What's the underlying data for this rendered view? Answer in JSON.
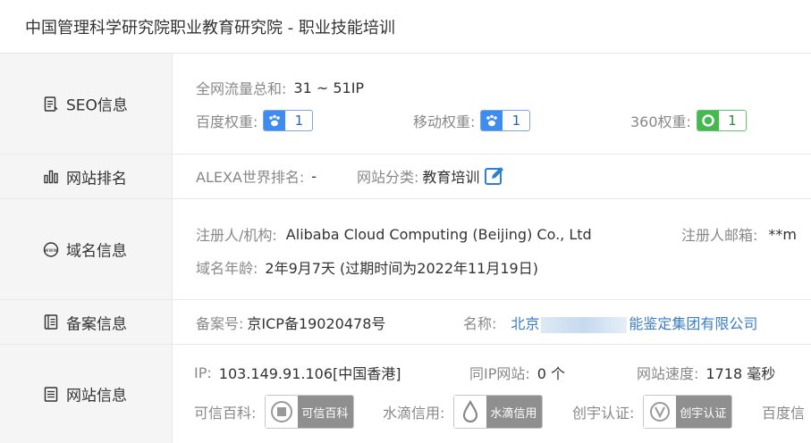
{
  "title": "中国管理科学研究院职业教育研究院 - 职业技能培训",
  "seo": {
    "label": "SEO信息",
    "traffic_label": "全网流量总和:",
    "traffic_value": "31 ~ 51IP",
    "baidu_label": "百度权重:",
    "baidu_value": "1",
    "mobile_label": "移动权重:",
    "mobile_value": "1",
    "w360_label": "360权重:",
    "w360_value": "1"
  },
  "rank": {
    "label": "网站排名",
    "alexa_label": "ALEXA世界排名:",
    "alexa_value": "-",
    "category_label": "网站分类:",
    "category_value": "教育培训"
  },
  "domain": {
    "label": "域名信息",
    "registrant_label": "注册人/机构:",
    "registrant_value": "Alibaba Cloud Computing (Beijing) Co., Ltd",
    "email_label": "注册人邮箱:",
    "email_value": "**m",
    "age_label": "域名年龄:",
    "age_value": "2年9月7天 (过期时间为2022年11月19日)"
  },
  "icp": {
    "label": "备案信息",
    "number_label": "备案号:",
    "number_value": "京ICP备19020478号",
    "name_label": "名称:",
    "name_prefix": "北京",
    "name_suffix": "能鉴定集团有限公司"
  },
  "site": {
    "label": "网站信息",
    "ip_label": "IP:",
    "ip_value": "103.149.91.106[中国香港]",
    "sameip_label": "同IP网站:",
    "sameip_value": "0 个",
    "speed_label": "网站速度:",
    "speed_value": "1718 毫秒",
    "kexin_label": "可信百科:",
    "kexin_badge": "可信百科",
    "shuidi_label": "水滴信用:",
    "shuidi_badge": "水滴信用",
    "chuangyu_label": "创宇认证:",
    "chuangyu_badge": "创宇认证",
    "baidu_xin_label": "百度信"
  },
  "colors": {
    "link": "#3b7cc6",
    "label_bg": "#f5f5f5",
    "baidu_badge": "#3f8cf0",
    "badge_360": "#45b94f"
  }
}
